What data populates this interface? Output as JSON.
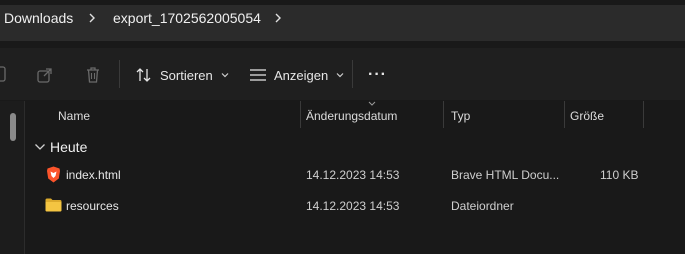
{
  "breadcrumb": {
    "items": [
      {
        "label": "Downloads"
      },
      {
        "label": "export_1702562005054"
      }
    ]
  },
  "toolbar": {
    "sort_label": "Sortieren",
    "view_label": "Anzeigen",
    "more_label": "···"
  },
  "columns": {
    "name": "Name",
    "modified": "Änderungsdatum",
    "type": "Typ",
    "size": "Größe"
  },
  "group": {
    "label": "Heute"
  },
  "files": [
    {
      "name": "index.html",
      "modified": "14.12.2023 14:53",
      "type": "Brave HTML Docu...",
      "size": "110 KB",
      "icon": "brave-html-file-icon"
    },
    {
      "name": "resources",
      "modified": "14.12.2023 14:53",
      "type": "Dateiordner",
      "size": "",
      "icon": "folder-icon"
    }
  ],
  "colors": {
    "background": "#191919",
    "address_bar": "#2b2b2b",
    "folder_yellow": "#f4c542",
    "brave_orange": "#fb542b"
  }
}
